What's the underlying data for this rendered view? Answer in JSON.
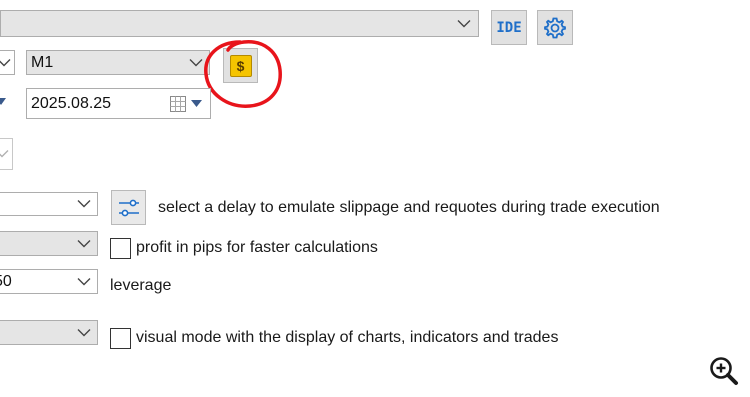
{
  "toolbar": {
    "ide_label": "IDE",
    "icons": {
      "settings": "gear-icon",
      "currency": "dollar-icon",
      "zoom": "zoom-in-icon"
    }
  },
  "settings": {
    "timeframe": "M1",
    "end_date": "2025.08.25",
    "leverage_value": "50"
  },
  "labels": {
    "delay_hint": "select a delay to emulate slippage and requotes during trade execution",
    "profit_pips": "profit in pips for faster calculations",
    "leverage": "leverage",
    "visual_mode": "visual mode with the display of charts, indicators and trades"
  },
  "checkboxes": {
    "profit_pips_checked": false,
    "visual_mode_checked": false
  },
  "colors": {
    "accent_blue": "#1f6fc9",
    "currency_yellow": "#f5c400",
    "annotation_red": "#e8141b"
  }
}
